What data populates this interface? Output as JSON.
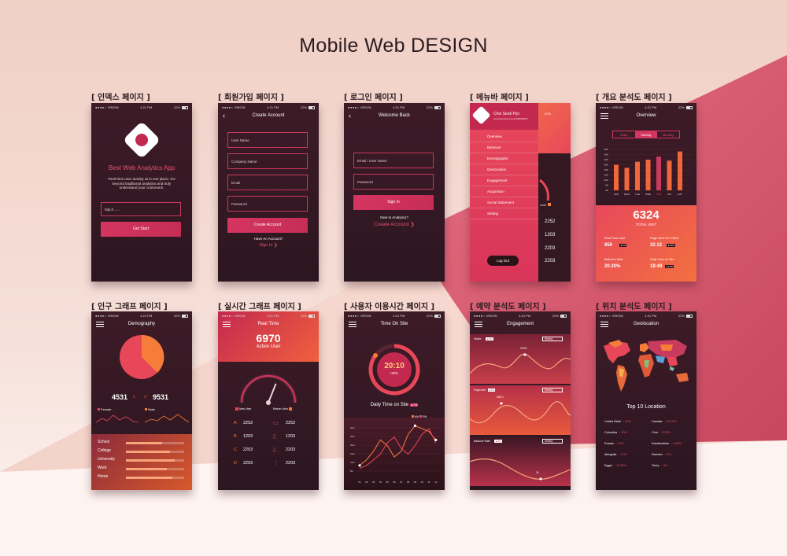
{
  "page": {
    "title": "Mobile Web DESIGN"
  },
  "captions": {
    "c1": "[ 인덱스 페이지 ]",
    "c2": "[ 회원가입 페이지 ]",
    "c3": "[ 로그인 페이지 ]",
    "c4": "[ 메뉴바 페이지 ]",
    "c5": "[ 개요 분석도 페이지 ]",
    "c6": "[ 인구 그래프 페이지 ]",
    "c7": "[ 실시간 그래프 페이지 ]",
    "c8": "[ 사용자 이용시간 페이지 ]",
    "c9": "[ 예약 분석도 페이지 ]",
    "c10": "[ 위치 분석도 페이지 ]"
  },
  "status": {
    "carrier": "VIRGIN",
    "time": "4:21 PM",
    "battery": "22%"
  },
  "index": {
    "app_title": "Best Web Analytics App",
    "desc": "Real-time user activity at in one place. Go beyond traditional analytics and truly understand your customers.",
    "url_placeholder": "http://.......",
    "start": "Get Start"
  },
  "signup": {
    "title": "Create Account",
    "user_name": "User Name",
    "company": "Company Name",
    "email": "Email",
    "password": "Password",
    "create": "Create Account",
    "have_account": "Have An Account?",
    "sign_in": "Sign In ❯"
  },
  "login": {
    "title": "Welcome Back",
    "email": "Email / User Name",
    "password": "Password",
    "sign_in": "Sign In",
    "new_to": "New to Analytics?",
    "create": "Create Account ❯"
  },
  "menu": {
    "name": "Choi Seok Pyo",
    "sub": "www.facebook.com/0108660820",
    "items": [
      "Overview",
      "Behavior",
      "Demographic",
      "Geolocation",
      "Engagement",
      "Acquisition",
      "Social Statement",
      "Setting"
    ],
    "logout": "Log Out",
    "side_label": "User",
    "side_values": [
      "2252",
      "1203",
      "2203",
      "2203"
    ]
  },
  "overview": {
    "title": "Overview",
    "tabs": [
      "Daily",
      "Weekly",
      "Monthly"
    ],
    "total": "6324",
    "total_label": "TOTAL VISIT",
    "stats": [
      {
        "label": "Real Time User",
        "value": "850",
        "badge": "▲7%"
      },
      {
        "label": "Page View Per Visitor",
        "value": "32.12",
        "badge": "▲10%"
      },
      {
        "label": "Ballunce Rate",
        "value": "20.20%",
        "badge": ""
      },
      {
        "label": "Daily Time on Site",
        "value": "18:49",
        "badge": "▲10%"
      }
    ]
  },
  "demography": {
    "title": "Demography",
    "female_count": "4531",
    "male_count": "9531",
    "female": "Female",
    "male": "Male",
    "categories": [
      "School",
      "College",
      "University",
      "Work",
      "Home"
    ],
    "bars": [
      0.62,
      0.75,
      0.84,
      0.7,
      0.8
    ]
  },
  "realtime": {
    "title": "Real Time",
    "count": "6970",
    "label": "Active User",
    "new_user": "New User",
    "return_user": "Return User",
    "gauge": 0.62,
    "rows": [
      {
        "letter": "A",
        "left": "2252",
        "right": "2252"
      },
      {
        "letter": "B",
        "left": "1203",
        "right": "1203"
      },
      {
        "letter": "C",
        "left": "2203",
        "right": "2203"
      },
      {
        "letter": "D",
        "left": "2203",
        "right": "2203"
      }
    ]
  },
  "timeon": {
    "title": "Time On Site",
    "time": "20:10",
    "hrs": "HRS",
    "caption": "Daily Time on Site",
    "badge": "▲7%",
    "legend": [
      "AM",
      "PM"
    ],
    "yticks": [
      "30m",
      "25m",
      "20m",
      "15m",
      "10m",
      "5m"
    ],
    "xticks": [
      "01",
      "02",
      "03",
      "04",
      "05",
      "06",
      "07",
      "08",
      "09",
      "10",
      "11",
      "12"
    ]
  },
  "engagement": {
    "title": "Engagement",
    "sections": [
      {
        "label": "Visitor",
        "chip": "▲7%",
        "select": "Weekly",
        "peak": "20161"
      },
      {
        "label": "Pageview",
        "chip": "▲7%",
        "select": "Weekly",
        "peak": "53871"
      },
      {
        "label": "Balance Rate",
        "chip": "▲7%",
        "select": "Weekly",
        "peak": "34"
      }
    ]
  },
  "geo": {
    "title": "Geolocation",
    "top10": "Top 10 Location",
    "left": [
      {
        "country": "United State",
        "pct": "~ 40%"
      },
      {
        "country": "Colombia",
        "pct": "~ 20%"
      },
      {
        "country": "Russia",
        "pct": "~ 12%"
      },
      {
        "country": "Mongolia",
        "pct": "~ 17%"
      },
      {
        "country": "Egypt",
        "pct": "~ 10.93%"
      }
    ],
    "right": [
      {
        "country": "Canada",
        "pct": "~ 10.12%"
      },
      {
        "country": "Chin",
        "pct": "~ 5.20%"
      },
      {
        "country": "Kazakhastan",
        "pct": "~ 5.86%"
      },
      {
        "country": "Sweden",
        "pct": "~ 3%"
      },
      {
        "country": "Turky",
        "pct": "~ 4%"
      }
    ]
  },
  "colors": {
    "accent": "#d43561",
    "orange": "#f57c3a",
    "bg": "#3d1b27"
  }
}
